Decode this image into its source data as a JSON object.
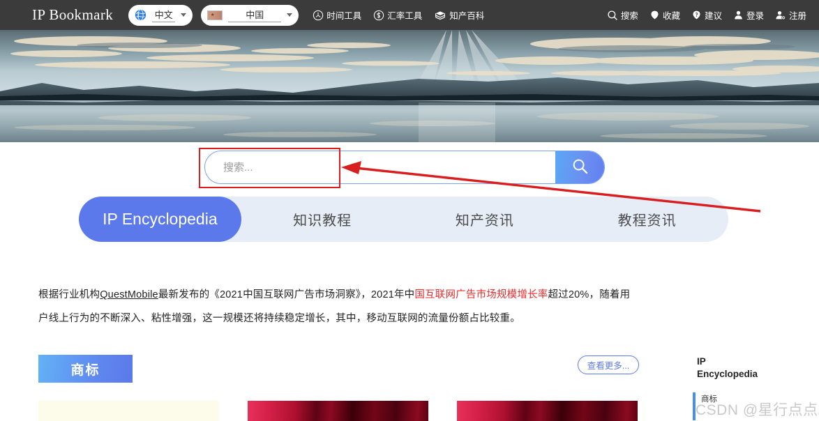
{
  "header": {
    "logo": "IP Bookmark",
    "language_select": {
      "value": "中文",
      "icon": "globe-icon"
    },
    "country_select": {
      "value": "中国",
      "icon": "flag-icon"
    },
    "nav_tools": [
      {
        "label": "时间工具",
        "icon": "clock-icon"
      },
      {
        "label": "汇率工具",
        "icon": "currency-icon"
      },
      {
        "label": "知产百科",
        "icon": "database-icon"
      }
    ],
    "nav_right": [
      {
        "label": "搜索",
        "icon": "search-icon"
      },
      {
        "label": "收藏",
        "icon": "bookmark-icon"
      },
      {
        "label": "建议",
        "icon": "feedback-icon"
      },
      {
        "label": "登录",
        "icon": "user-icon"
      },
      {
        "label": "注册",
        "icon": "user-add-icon"
      }
    ],
    "background_color": "#3b3b3b"
  },
  "banner": {
    "alt": "lake reflection landscape with mountains and sun rays"
  },
  "search": {
    "placeholder": "搜索...",
    "value": "",
    "button_icon": "magnifier-icon",
    "button_color": "#5f7ff0"
  },
  "annotation": {
    "rect_color": "#e01b1b",
    "arrow_color": "#d81e1e"
  },
  "tabs": {
    "items": [
      {
        "label": "IP Encyclopedia",
        "active": true
      },
      {
        "label": "知识教程",
        "active": false
      },
      {
        "label": "知产资讯",
        "active": false
      },
      {
        "label": "教程资讯",
        "active": false
      }
    ],
    "active_color": "#5b79ea",
    "track_color": "#e6edf7"
  },
  "article": {
    "line1_a": "根据行业机构",
    "line1_link": "QuestMobile",
    "line1_b": "最新发布的《2021中国互联网广告市场洞察》，2021年中",
    "line1_red": "国互联网广告市场规模增长率",
    "line1_c": "超过20%，随着用",
    "line2": "户线上行为的不断深入、粘性增强，这一规模还将持续稳定增长，其中，移动互联网的流量份额占比较重。",
    "highlight_color": "#ea2b2b"
  },
  "section": {
    "title": "商标",
    "more_label": "查看更多...",
    "cards": [
      {
        "thumb": "cream"
      },
      {
        "thumb": "red"
      },
      {
        "thumb": "red"
      }
    ]
  },
  "sidebar": {
    "title": "IP\nEncyclopedia",
    "title_line1": "IP",
    "title_line2": "Encyclopedia",
    "items": [
      {
        "label": "商标",
        "active": true
      }
    ]
  },
  "watermark": {
    "text": "CSDN @星行点点。"
  }
}
